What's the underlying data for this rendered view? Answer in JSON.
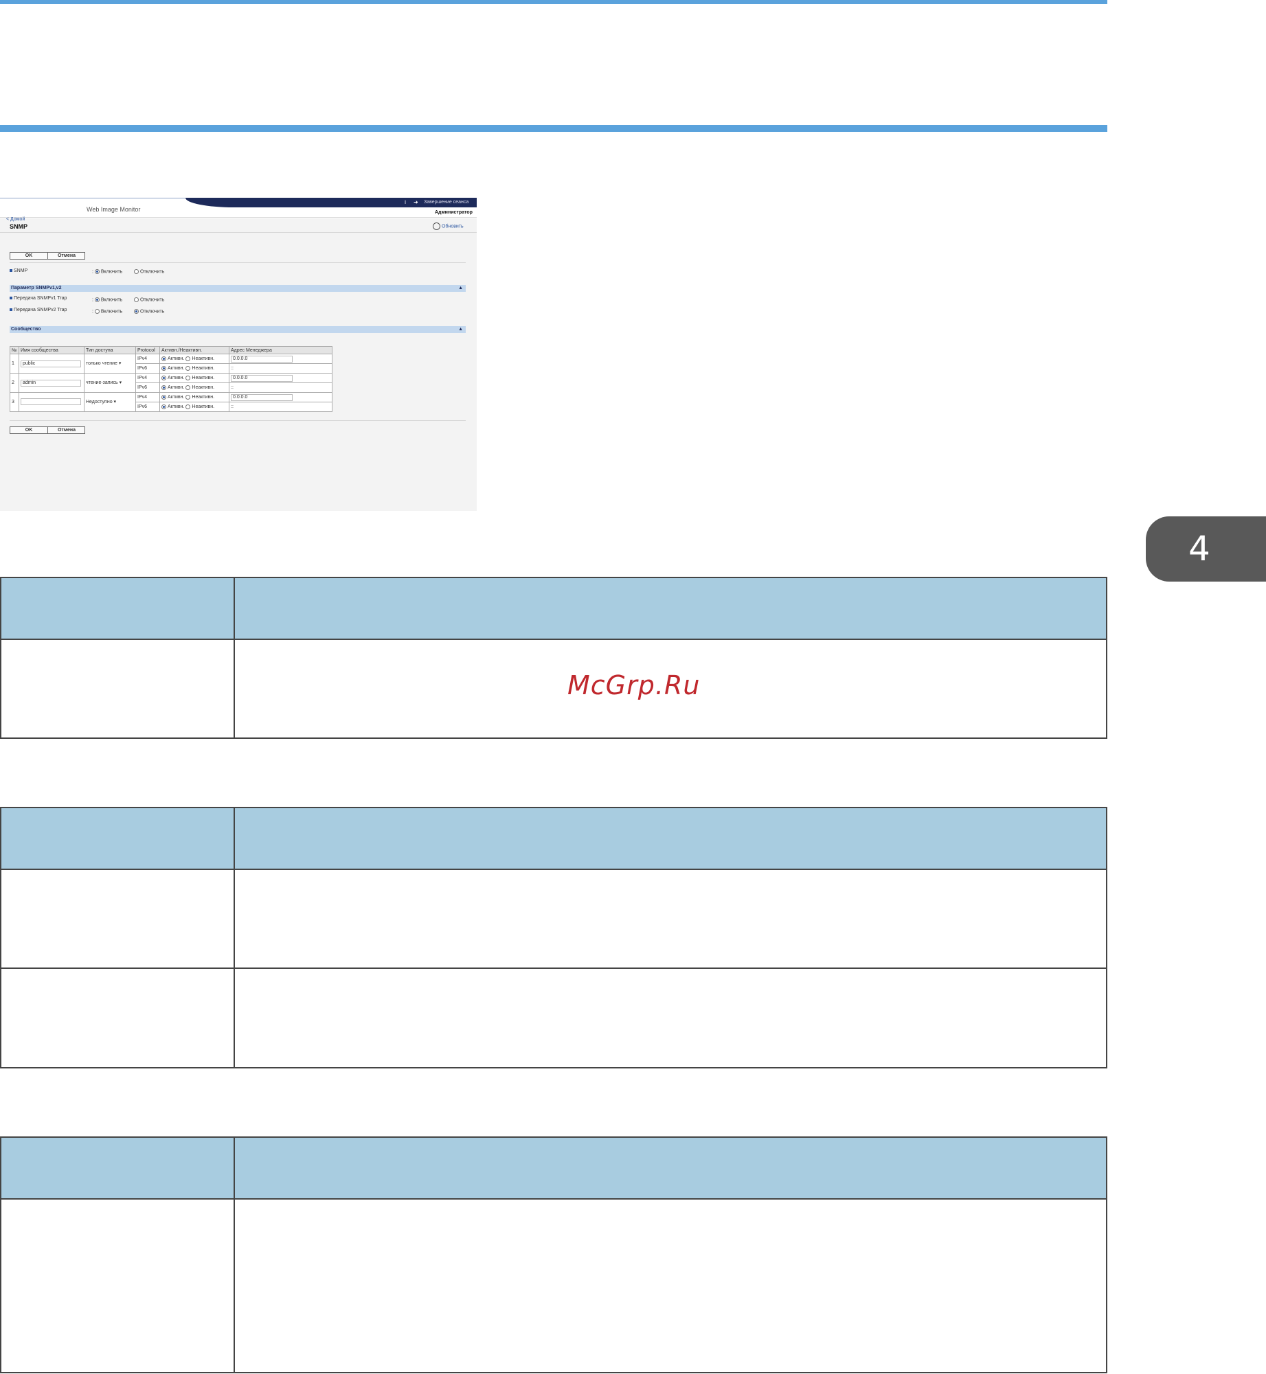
{
  "chapter_number": "4",
  "watermark": "McGrp.Ru",
  "screenshot": {
    "app_title": "Web Image Monitor",
    "logout_label": "Завершение сеанса",
    "user_label": "Администратор",
    "back_link": "< Домой",
    "page_title": "SNMP",
    "refresh_label": "Обновить",
    "ok_label": "OK",
    "cancel_label": "Отмена",
    "snmp_label": "SNMP",
    "enable_label": "Включить",
    "disable_label": "Отключить",
    "section_v1v2": "Параметр SNMPv1,v2",
    "trap_v1_label": "Передача SNMPv1 Trap",
    "trap_v2_label": "Передача SNMPv2 Trap",
    "section_community": "Сообщество",
    "table_headers": [
      "№",
      "Имя сообщества",
      "Тип доступа",
      "Protocol",
      "Активн./Неактивн.",
      "Адрес Менеджера"
    ],
    "active_label": "Активн.",
    "inactive_label": "Неактивн.",
    "rows": [
      {
        "no": "1",
        "name": "public",
        "access": "только чтение",
        "ipv4": "IPv4",
        "ipv6": "IPv6",
        "addr4": "0.0.0.0",
        "addr6": "::"
      },
      {
        "no": "2",
        "name": "admin",
        "access": "чтение-запись",
        "ipv4": "IPv4",
        "ipv6": "IPv6",
        "addr4": "0.0.0.0",
        "addr6": "::"
      },
      {
        "no": "3",
        "name": "",
        "access": "Недоступно",
        "ipv4": "IPv4",
        "ipv6": "IPv6",
        "addr4": "0.0.0.0",
        "addr6": "::"
      }
    ]
  },
  "colors": {
    "accent_rule": "#5aa2dc",
    "table_header": "#a8cce0",
    "chapter_tab": "#595959",
    "watermark": "#c0282d"
  }
}
